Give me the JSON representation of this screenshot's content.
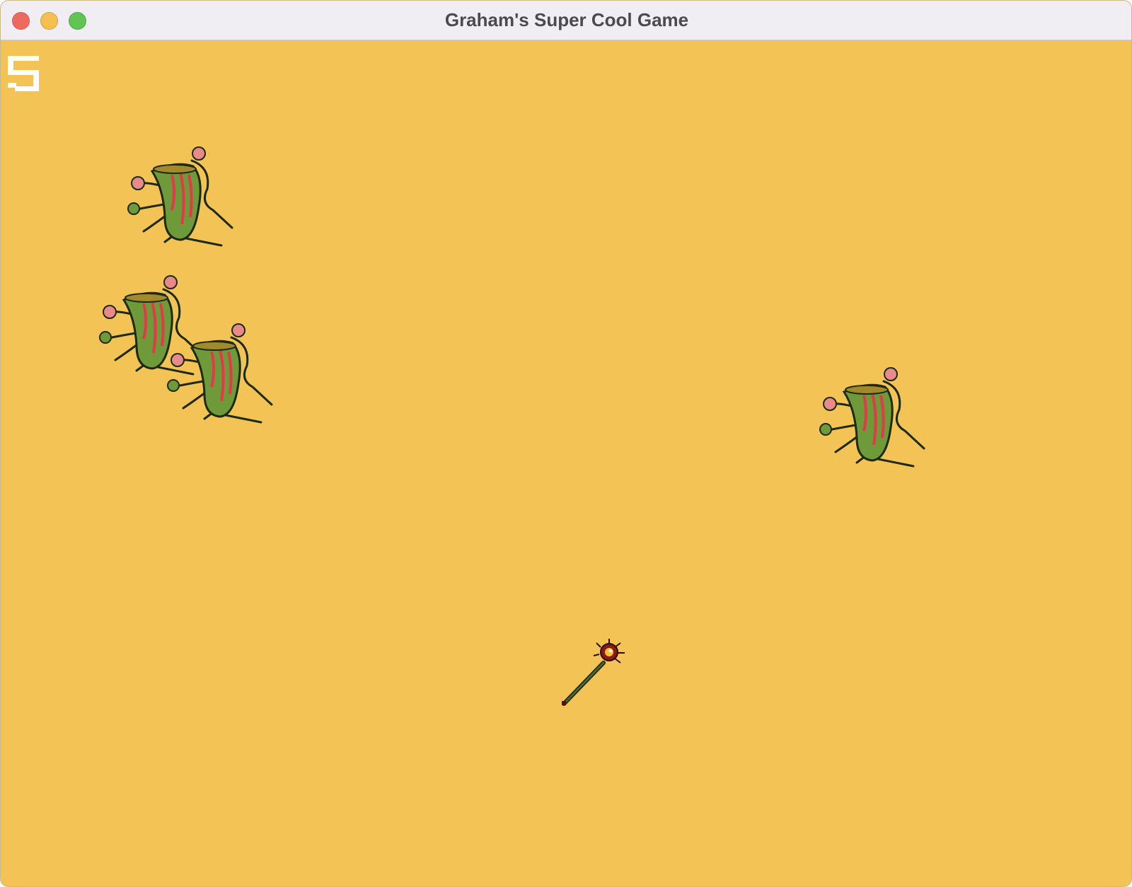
{
  "window": {
    "title": "Graham's Super Cool Game"
  },
  "hud": {
    "score": "5"
  },
  "colors": {
    "background": "#f3c355",
    "titlebar": "#f0eef3",
    "close": "#ee6a5f",
    "minimize": "#f5bf4f",
    "zoom": "#61c454",
    "score_digit": "#ffffff"
  },
  "sprites": {
    "enemies": [
      {
        "name": "plant-monster"
      },
      {
        "name": "plant-monster"
      },
      {
        "name": "plant-monster"
      },
      {
        "name": "plant-monster"
      }
    ],
    "player": {
      "name": "magic-staff"
    }
  }
}
